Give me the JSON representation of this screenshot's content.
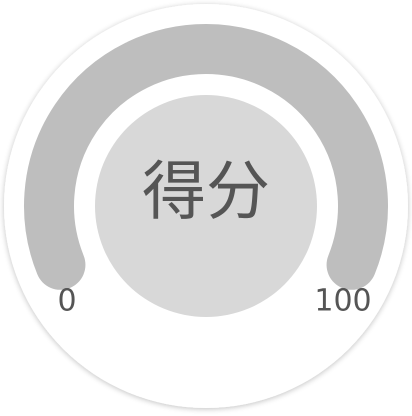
{
  "chart_data": {
    "type": "gauge",
    "title": "",
    "center_label": "得分",
    "min": 0,
    "max": 100,
    "value": null,
    "min_label": "0",
    "max_label": "100",
    "track_color": "#bebebe",
    "center_fill": "#d8d8d8",
    "outer_fill": "#ffffff",
    "text_color": "#555555"
  }
}
